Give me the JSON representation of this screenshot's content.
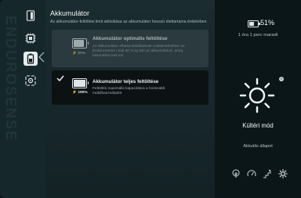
{
  "sidebar": {
    "brand": "ENDUROSENSE",
    "items": [
      {
        "icon": "phone-icon"
      },
      {
        "icon": "cpu-icon"
      },
      {
        "icon": "battery-icon",
        "active": true
      },
      {
        "icon": "settings-hex-icon"
      }
    ]
  },
  "main": {
    "title": "Akkumulátor",
    "subtitle": "Az akkumulátor-feltöltési limit aktiválása az akkumulátor hosszú élettartama érdekében",
    "options": [
      {
        "title": "Akkumulátor optimális feltöltése",
        "description_lines": [
          "Az akkumulátor elhasználódásának csökkentéséhez az",
          "EnduroSense csak 80 %-ig tölti az akkumulátort, amíg",
          "használnia kell ezt"
        ],
        "percent_label": "80%",
        "level": 0.8,
        "selected": false
      },
      {
        "title": "Akkumulátor teljes feltöltése",
        "description_lines": [
          "Feltöltés maximális kapacitásra a hosszabb",
          "mobilhasználatért"
        ],
        "percent_label": "100%",
        "level": 1.0,
        "selected": true
      }
    ]
  },
  "status": {
    "battery_percent": "51%",
    "battery_level": 0.51,
    "remaining": "1 óra 1 perc maradt",
    "mode_name": "Kültéri mód",
    "current_state_label": "Aktuális állapot",
    "info_badge": "i"
  },
  "modes": [
    {
      "icon": "tree-icon"
    },
    {
      "icon": "speedometer-icon"
    },
    {
      "icon": "climb-icon"
    },
    {
      "icon": "sun-icon",
      "active": true
    }
  ],
  "colors": {
    "accent": "#e6ecee",
    "panel": "#1a2c30",
    "background": "#0b1618"
  }
}
